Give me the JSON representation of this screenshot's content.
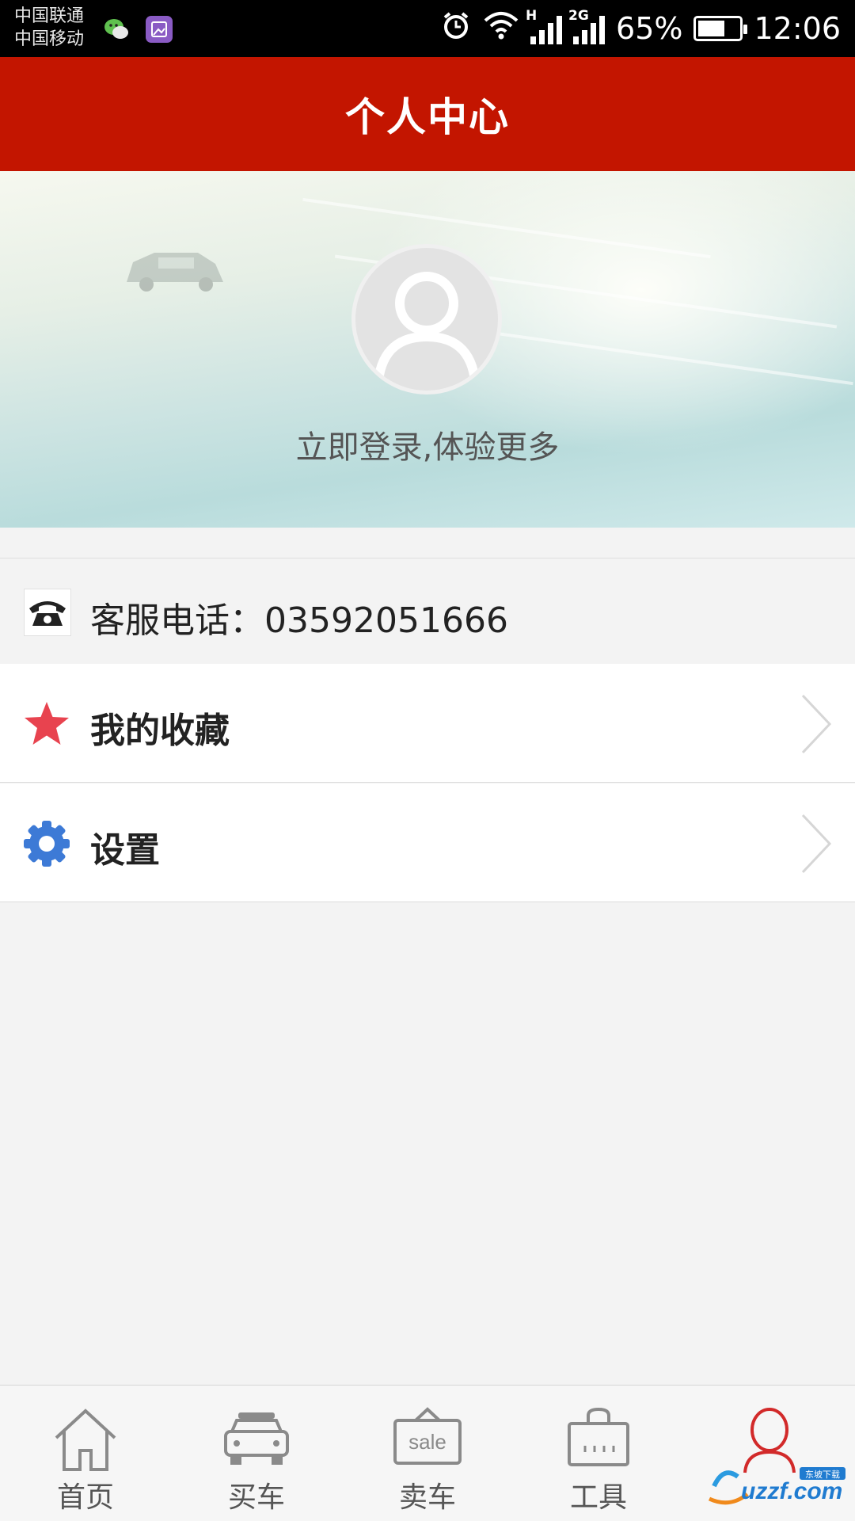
{
  "status_bar": {
    "carrier_1": "中国联通",
    "carrier_2": "中国移动",
    "network_tag_1": "H",
    "network_tag_2": "2G",
    "battery": "65%",
    "battery_level": 0.65,
    "time": "12:06",
    "icons": [
      "wechat-icon",
      "gallery-icon",
      "alarm-icon",
      "wifi-icon",
      "signal-icon",
      "battery-icon"
    ]
  },
  "header": {
    "title": "个人中心"
  },
  "profile": {
    "login_prompt": "立即登录,体验更多",
    "avatar_icon": "user-silhouette-icon"
  },
  "service": {
    "label": "客服电话：",
    "phone": "03592051666",
    "icon": "telephone-icon"
  },
  "menu": [
    {
      "label": "我的收藏",
      "icon": "star-icon",
      "color": "#e8434f"
    },
    {
      "label": "设置",
      "icon": "gear-icon",
      "color": "#3d7ad6"
    }
  ],
  "bottom_nav": [
    {
      "label": "首页",
      "icon": "home-icon",
      "active": false
    },
    {
      "label": "买车",
      "icon": "car-icon",
      "active": false
    },
    {
      "label": "卖车",
      "icon": "sale-tag-icon",
      "active": false,
      "icon_text": "sale"
    },
    {
      "label": "工具",
      "icon": "toolbag-icon",
      "active": false
    },
    {
      "label": "",
      "icon": "profile-icon",
      "active": true
    }
  ],
  "watermark": {
    "text": "uzzf.com",
    "brand_text": "东坡下载"
  },
  "colors": {
    "header_red": "#c31500",
    "active_red": "#d22a2a",
    "star_red": "#e8434f",
    "gear_blue": "#3d7ad6"
  }
}
